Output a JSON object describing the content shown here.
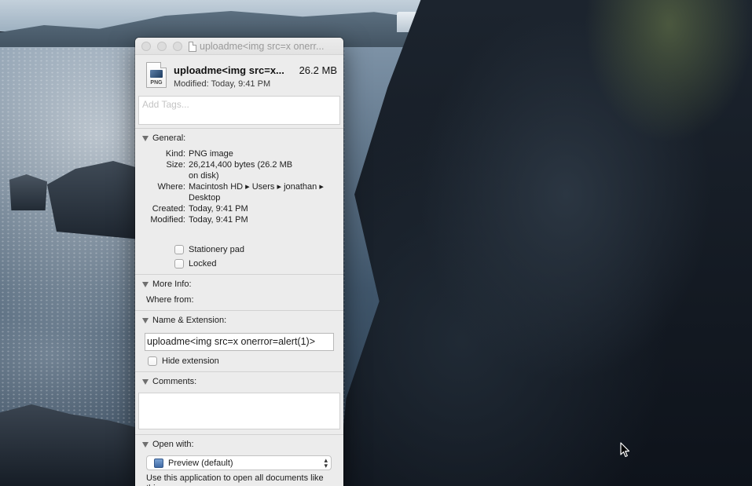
{
  "window": {
    "title": "uploadme<img src=x onerr..."
  },
  "file": {
    "name": "uploadme<img src=x...",
    "size": "26.2 MB",
    "modified_line": "Modified: Today, 9:41 PM",
    "icon_ext": "PNG"
  },
  "tags": {
    "placeholder": "Add Tags..."
  },
  "general": {
    "header": "General:",
    "rows": [
      {
        "key": "Kind:",
        "value": "PNG image"
      },
      {
        "key": "Size:",
        "value": "26,214,400 bytes (26.2 MB on disk)"
      },
      {
        "key": "Where:",
        "value": "Macintosh HD ▸ Users ▸ jonathan ▸ Desktop"
      },
      {
        "key": "Created:",
        "value": "Today, 9:41 PM"
      },
      {
        "key": "Modified:",
        "value": "Today, 9:41 PM"
      }
    ],
    "stationery_label": "Stationery pad",
    "locked_label": "Locked"
  },
  "more_info": {
    "header": "More Info:",
    "where_from_label": "Where from:"
  },
  "name_extension": {
    "header": "Name & Extension:",
    "value": "uploadme<img src=x onerror=alert(1)>",
    "hide_extension_label": "Hide extension"
  },
  "comments": {
    "header": "Comments:"
  },
  "open_with": {
    "header": "Open with:",
    "selected": "Preview (default)",
    "note": "Use this application to open all documents like this one."
  },
  "icons": {
    "close": "close-icon",
    "minimize": "minimize-icon",
    "zoom": "zoom-icon",
    "document": "document-icon",
    "disclosure": "disclosure-triangle-icon",
    "cursor": "arrow-cursor-icon"
  }
}
